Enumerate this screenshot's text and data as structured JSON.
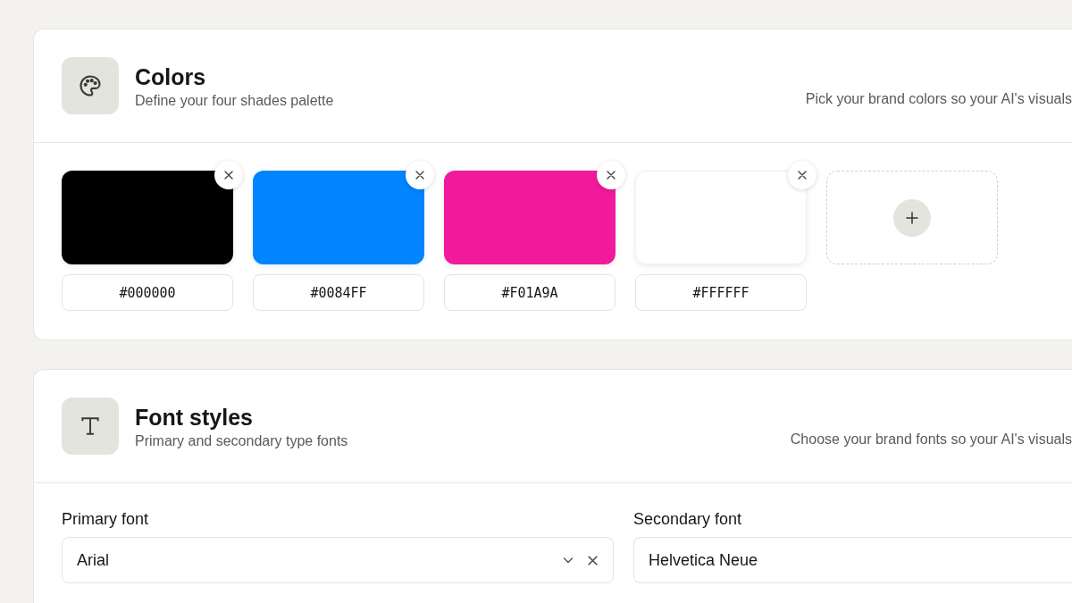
{
  "colors": {
    "title": "Colors",
    "subtitle": "Define your four shades palette",
    "description": "Pick your brand colors so your AI's visuals",
    "swatches": [
      {
        "color": "#000000",
        "value": "#000000"
      },
      {
        "color": "#0084ff",
        "value": "#0084FF"
      },
      {
        "color": "#f01a9a",
        "value": "#F01A9A"
      },
      {
        "color": "#ffffff",
        "value": "#FFFFFF"
      }
    ],
    "add_tile": {
      "kind": "add"
    }
  },
  "fonts": {
    "title": "Font styles",
    "subtitle": "Primary and secondary type fonts",
    "description": "Choose your brand fonts so your AI's visuals",
    "fields": [
      {
        "label": "Primary font",
        "value": "Arial",
        "kind": "select"
      },
      {
        "label": "Secondary font",
        "value": "Helvetica Neue",
        "kind": "text"
      }
    ]
  }
}
